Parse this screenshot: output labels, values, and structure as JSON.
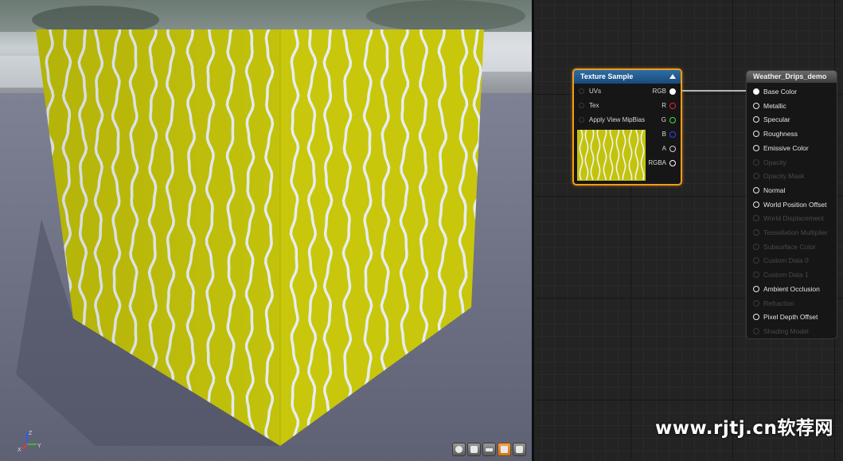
{
  "viewport": {
    "axis": {
      "x": "X",
      "y": "Y",
      "z": "Z"
    },
    "toolbar": [
      "sphere-shape-icon",
      "cylinder-shape-icon",
      "plane-shape-icon",
      "cube-shape-icon",
      "custom-mesh-icon"
    ],
    "active_tool_index": 3
  },
  "texture_node": {
    "title": "Texture Sample",
    "inputs": [
      "UVs",
      "Tex",
      "Apply View MipBias"
    ],
    "outputs": [
      {
        "label": "RGB",
        "color": "#ffffff",
        "filled": true
      },
      {
        "label": "R",
        "color": "#e8262b",
        "filled": false
      },
      {
        "label": "G",
        "color": "#3fe23b",
        "filled": false
      },
      {
        "label": "B",
        "color": "#2c45e6",
        "filled": false
      },
      {
        "label": "A",
        "color": "#d0d0d0",
        "filled": false
      },
      {
        "label": "RGBA",
        "color": "#ffffff",
        "filled": false
      }
    ]
  },
  "material_node": {
    "title": "Weather_Drips_demo",
    "pins": [
      {
        "label": "Base Color",
        "enabled": true,
        "connected": true
      },
      {
        "label": "Metallic",
        "enabled": true,
        "connected": false
      },
      {
        "label": "Specular",
        "enabled": true,
        "connected": false
      },
      {
        "label": "Roughness",
        "enabled": true,
        "connected": false
      },
      {
        "label": "Emissive Color",
        "enabled": true,
        "connected": false
      },
      {
        "label": "Opacity",
        "enabled": false,
        "connected": false
      },
      {
        "label": "Opacity Mask",
        "enabled": false,
        "connected": false
      },
      {
        "label": "Normal",
        "enabled": true,
        "connected": false
      },
      {
        "label": "World Position Offset",
        "enabled": true,
        "connected": false
      },
      {
        "label": "World Displacement",
        "enabled": false,
        "connected": false
      },
      {
        "label": "Tessellation Multiplier",
        "enabled": false,
        "connected": false
      },
      {
        "label": "Subsurface Color",
        "enabled": false,
        "connected": false
      },
      {
        "label": "Custom Data 0",
        "enabled": false,
        "connected": false
      },
      {
        "label": "Custom Data 1",
        "enabled": false,
        "connected": false
      },
      {
        "label": "Ambient Occlusion",
        "enabled": true,
        "connected": false
      },
      {
        "label": "Refraction",
        "enabled": false,
        "connected": false
      },
      {
        "label": "Pixel Depth Offset",
        "enabled": true,
        "connected": false
      },
      {
        "label": "Shading Model",
        "enabled": false,
        "connected": false
      }
    ]
  },
  "colors": {
    "texture_yellow": "#c4c30c",
    "drip_white": "#e4ecf2",
    "selection_orange": "#f39c1d",
    "node_header_blue": "#2d6da5"
  },
  "watermark": "www.rjtj.cn软荐网"
}
